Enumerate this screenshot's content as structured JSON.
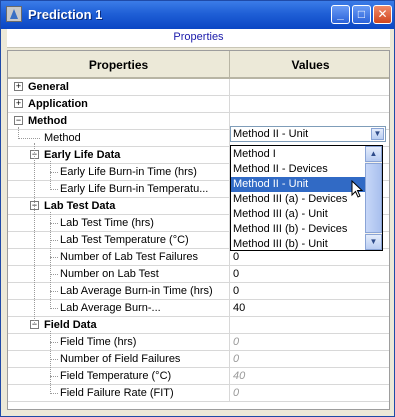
{
  "window": {
    "title": "Prediction 1",
    "min_glyph": "_",
    "max_glyph": "□",
    "close_glyph": "✕"
  },
  "header_link": "Properties",
  "columns": {
    "properties": "Properties",
    "values": "Values"
  },
  "sections": {
    "general": {
      "label": "General",
      "expander": "+"
    },
    "application": {
      "label": "Application",
      "expander": "+"
    },
    "method": {
      "label": "Method",
      "expander": "−"
    }
  },
  "method_row": {
    "label": "Method",
    "value": "Method II - Unit"
  },
  "early_life": {
    "label": "Early Life Data",
    "expander": "−",
    "rows": [
      {
        "label": "Early Life Burn-in Time (hrs)",
        "value": ""
      },
      {
        "label": "Early Life Burn-in Temperatu...",
        "value": ""
      }
    ]
  },
  "lab_test": {
    "label": "Lab Test Data",
    "expander": "−",
    "rows": [
      {
        "label": "Lab Test Time (hrs)",
        "value": ""
      },
      {
        "label": "Lab Test Temperature (°C)",
        "value": ""
      },
      {
        "label": "Number of Lab Test Failures",
        "value": "0"
      },
      {
        "label": "Number on Lab Test",
        "value": "0"
      },
      {
        "label": "Lab Average Burn-in Time (hrs)",
        "value": "0"
      },
      {
        "label": "Lab Average Burn-...",
        "value": "40"
      }
    ]
  },
  "field": {
    "label": "Field Data",
    "expander": "−",
    "rows": [
      {
        "label": "Field Time (hrs)",
        "value": "0"
      },
      {
        "label": "Number of Field Failures",
        "value": "0"
      },
      {
        "label": "Field Temperature (°C)",
        "value": "40"
      },
      {
        "label": "Field Failure Rate (FIT)",
        "value": "0"
      }
    ]
  },
  "dropdown": {
    "options": [
      "Method I",
      "Method II - Devices",
      "Method II - Unit",
      "Method III (a) - Devices",
      "Method III (a) - Unit",
      "Method III (b) - Devices",
      "Method III (b) - Unit"
    ],
    "selected_index": 2,
    "scroll_up": "▲",
    "scroll_down": "▼",
    "combo_arrow": "▼"
  },
  "colors": {
    "selection": "#316ac5",
    "titlebar": "#0a46c4"
  }
}
